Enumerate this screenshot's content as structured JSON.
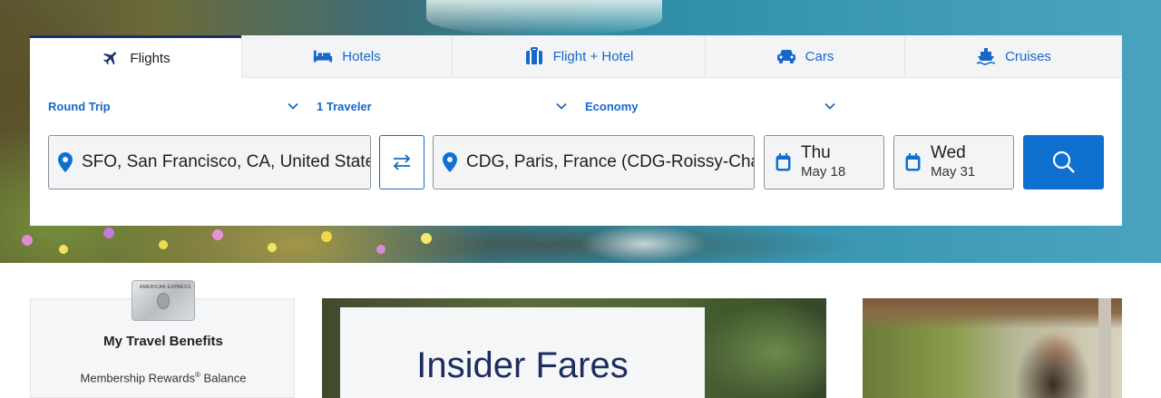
{
  "tabs": [
    {
      "label": "Flights",
      "icon": "airplane-icon",
      "active": true
    },
    {
      "label": "Hotels",
      "icon": "bed-icon",
      "active": false
    },
    {
      "label": "Flight + Hotel",
      "icon": "luggage-icon",
      "active": false
    },
    {
      "label": "Cars",
      "icon": "car-icon",
      "active": false
    },
    {
      "label": "Cruises",
      "icon": "ship-icon",
      "active": false
    }
  ],
  "selectors": {
    "trip_type": "Round Trip",
    "travelers": "1 Traveler",
    "cabin": "Economy"
  },
  "search": {
    "origin": "SFO, San Francisco, CA, United States",
    "destination": "CDG, Paris, France (CDG-Roissy-Charles de Gaulle)",
    "depart": {
      "day": "Thu",
      "date": "May 18"
    },
    "return": {
      "day": "Wed",
      "date": "May 31"
    }
  },
  "benefits": {
    "title": "My Travel Benefits",
    "balance_label": "Membership Rewards",
    "balance_label_suffix": " Balance",
    "card_text": "AMERICAN EXPRESS"
  },
  "promo": {
    "headline": "Insider Fares"
  },
  "colors": {
    "accent": "#1070d0",
    "link": "#1867c8",
    "active_tab_border": "#1a2f6b"
  }
}
